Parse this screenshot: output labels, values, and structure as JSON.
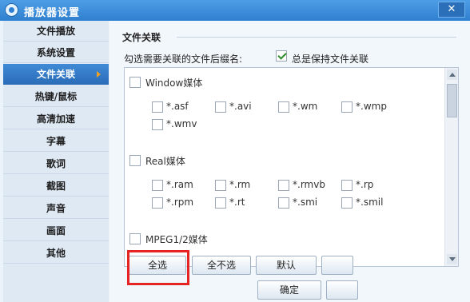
{
  "window": {
    "title": "播放器设置",
    "close_glyph": "✕"
  },
  "sidebar": {
    "items": [
      {
        "label": "文件播放"
      },
      {
        "label": "系统设置"
      },
      {
        "label": "文件关联",
        "active": true
      },
      {
        "label": "热键/鼠标"
      },
      {
        "label": "高清加速"
      },
      {
        "label": "字幕"
      },
      {
        "label": "歌词"
      },
      {
        "label": "截图"
      },
      {
        "label": "声音"
      },
      {
        "label": "画面"
      },
      {
        "label": "其他"
      }
    ]
  },
  "content": {
    "section_title": "文件关联",
    "prompt": "勾选需要关联的文件后缀名:",
    "keep_association": {
      "label": "总是保持文件关联",
      "checked": true
    },
    "groups": [
      {
        "label": "Window媒体",
        "checked": false,
        "extensions": [
          "*.asf",
          "*.avi",
          "*.wm",
          "*.wmp",
          "*.wmv"
        ]
      },
      {
        "label": "Real媒体",
        "checked": false,
        "extensions": [
          "*.ram",
          "*.rm",
          "*.rmvb",
          "*.rp",
          "*.rpm",
          "*.rt",
          "*.smi",
          "*.smil"
        ]
      },
      {
        "label": "MPEG1/2媒体",
        "checked": false,
        "extensions": []
      }
    ]
  },
  "buttons": {
    "select_all": "全选",
    "select_none": "全不选",
    "default": "默认",
    "ok": "确定"
  },
  "colors": {
    "accent": "#2f7fd0",
    "highlight": "#e62424",
    "check": "#2a8a2a"
  }
}
